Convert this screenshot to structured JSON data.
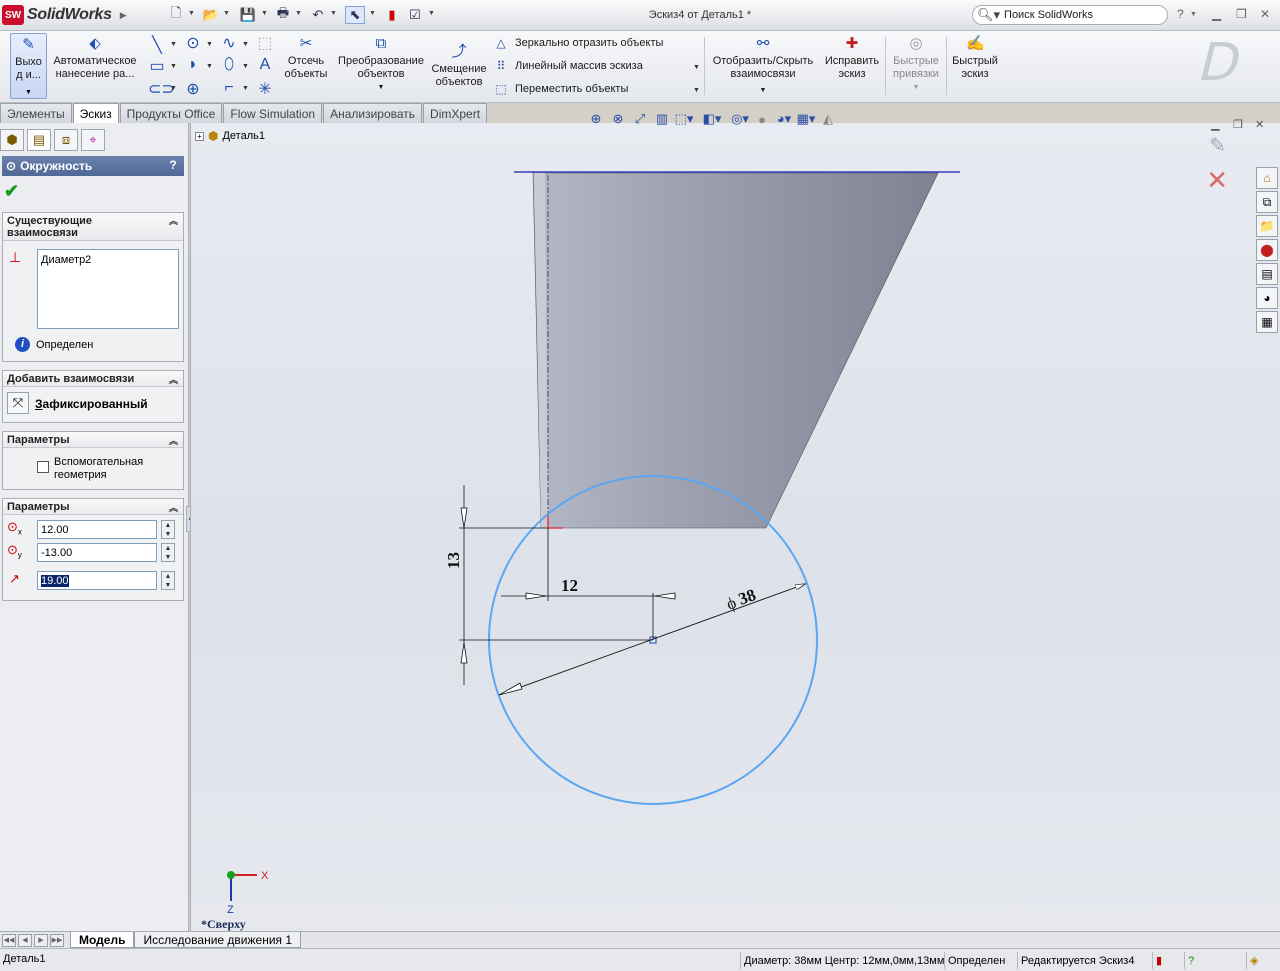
{
  "app": {
    "brand": "SolidWorks",
    "brand_badge": "SW",
    "document_title": "Эскиз4 от Деталь1 *",
    "search_placeholder": "Поиск SolidWorks",
    "help_glyph": "?"
  },
  "commands": {
    "exit_sketch": "Выхо д и...",
    "smart_dimension": "Автоматическое нанесение ра...",
    "trim": "Отсечь объекты",
    "convert": "Преобразование объектов",
    "offset": "Смещение объектов",
    "mirror": "Зеркально отразить объекты",
    "linear_pattern": "Линейный массив эскиза",
    "move": "Переместить объекты",
    "display_relations": "Отобразить/Скрыть взаимосвязи",
    "repair_sketch": "Исправить эскиз",
    "quick_snaps": "Быстрые привязки",
    "rapid_sketch": "Быстрый эскиз"
  },
  "tabs": [
    "Элементы",
    "Эскиз",
    "Продукты Office",
    "Flow Simulation",
    "Анализировать",
    "DimXpert"
  ],
  "active_tab": "Эскиз",
  "property_manager": {
    "title": "Окружность",
    "help": "?",
    "existing_relations": {
      "title": "Существующие взаимосвязи",
      "items": [
        "Диаметр2"
      ],
      "status": "Определен"
    },
    "add_relations": {
      "title": "Добавить взаимосвязи",
      "fixed_label_prefix": "З",
      "fixed_label_rest": "афиксированный"
    },
    "options": {
      "title": "Параметры",
      "construction_label": "Вспомогательная геометрия",
      "construction_checked": false
    },
    "parameters": {
      "title": "Параметры",
      "center_x": "12.00",
      "center_y": "-13.00",
      "radius": "19.00"
    }
  },
  "tree": {
    "root": "Деталь1"
  },
  "viewport": {
    "view_name": "*Сверху",
    "dims": {
      "vertical": "13",
      "horizontal": "12",
      "diameter": "38"
    },
    "triad": {
      "x": "X",
      "z": "Z"
    }
  },
  "bottom_tabs": [
    "Модель",
    "Исследование движения 1"
  ],
  "status": {
    "doc": "Деталь1",
    "info": "Диаметр: 38мм  Центр: 12мм,0мм,13мм",
    "defined": "Определен",
    "editing": "Редактируется Эскиз4"
  },
  "colors": {
    "circle": "#5aa6f2",
    "sketch_line": "#1a1aaf",
    "pm_header": "#5a72a0"
  }
}
